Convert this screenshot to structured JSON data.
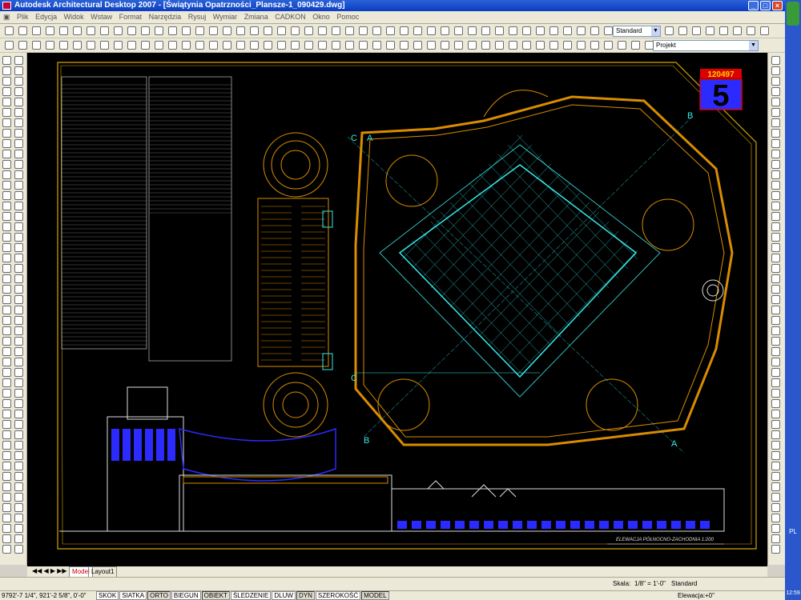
{
  "window": {
    "title": "Autodesk Architectural Desktop 2007 - [Świątynia Opatrzności_Plansze-1_090429.dwg]"
  },
  "menu": [
    "Plik",
    "Edycja",
    "Widok",
    "Wstaw",
    "Format",
    "Narzędzia",
    "Rysuj",
    "Wymiar",
    "Zmiana",
    "CADKON",
    "Okno",
    "Pomoc"
  ],
  "toolbar": {
    "style_value": "Standard",
    "layer_value": "Projekt"
  },
  "drawing": {
    "sheet_code": "120497",
    "sheet_number": "5",
    "elevation_caption": "ELEWACJA  PÓŁNOCNO-ZACHODNIA   1:200",
    "section_marks": [
      "C",
      "C",
      "B",
      "B",
      "A",
      "A"
    ],
    "colors": {
      "frame": "#d9a300",
      "cyan": "#38e8e8",
      "orange": "#d98c00",
      "white": "#e0e0e0",
      "blue": "#2b2bff"
    }
  },
  "layout_tabs": [
    "Model",
    "Layout1"
  ],
  "annotation": {
    "scale_label": "Skala:",
    "scale_value": "1/8\" = 1'-0\"",
    "style_value": "Standard"
  },
  "status": {
    "coords": "9792'-7 1/4\", 921'-2 5/8\", 0'-0\"",
    "toggles": [
      "SKOK",
      "SIATKA",
      "ORTO",
      "BIEGUN",
      "OBIEKT",
      "ŚLEDZENIE",
      "DLUW",
      "DYN",
      "SZEROKOŚĆ",
      "MODEL"
    ],
    "elevation_label": "Elewacja:",
    "elevation_value": "+0\""
  },
  "taskbar": {
    "lang": "PL",
    "clock": "12:59"
  }
}
